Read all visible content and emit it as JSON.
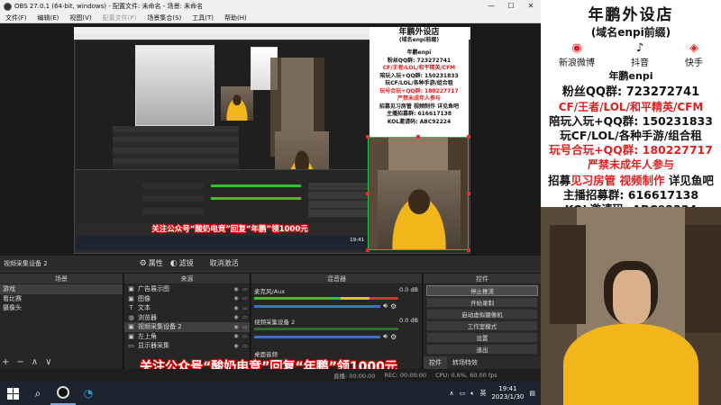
{
  "window": {
    "title": "OBS 27.0.1 (64-bit, windows) - 配置文件: 未命名 - 场景: 未命名",
    "controls": [
      "—",
      "☐",
      "✕"
    ]
  },
  "menu": [
    "文件(F)",
    "编辑(E)",
    "视图(V)",
    "配置文件(P)",
    "场景集合(S)",
    "工具(T)",
    "帮助(H)"
  ],
  "preview": {
    "nested_caption": "关注公众号“酸奶电竞”回复“年鹏”领1000元",
    "nested_time": "19:41"
  },
  "scene_bar": {
    "selected_source": "视频采集设备 2",
    "properties_label": "属性",
    "filters_label": "滤镜",
    "deactivate_label": "取消激活"
  },
  "docks": {
    "scenes_header": "场景",
    "sources_header": "来源",
    "mixer_header": "混音器",
    "controls_header": "控件"
  },
  "scenes": [
    "游戏",
    "看比赛",
    "摄像头"
  ],
  "sources": [
    {
      "icon": "image-icon",
      "glyph": "▣",
      "label": "广告展示图"
    },
    {
      "icon": "image-icon",
      "glyph": "▣",
      "label": "图像"
    },
    {
      "icon": "text-icon",
      "glyph": "T",
      "label": "文本"
    },
    {
      "icon": "globe-icon",
      "glyph": "◍",
      "label": "浏览器"
    },
    {
      "icon": "camera-icon",
      "glyph": "▣",
      "label": "视频采集设备 2"
    },
    {
      "icon": "image-icon",
      "glyph": "▣",
      "label": "左上角"
    },
    {
      "icon": "monitor-icon",
      "glyph": "▭",
      "label": "显示器采集"
    }
  ],
  "mixer": [
    {
      "name": "麦克风/Aux",
      "db": "0.0 dB"
    },
    {
      "name": "视频采集设备 2",
      "db": "0.0 dB"
    },
    {
      "name": "桌面音频",
      "db": ""
    }
  ],
  "controls": [
    "停止推流",
    "开始录制",
    "启动虚拟摄像机",
    "工作室模式",
    "设置",
    "退出"
  ],
  "controls_tabs": [
    "控件",
    "转场特效"
  ],
  "dock_toolbar": [
    "+",
    "−",
    "∧",
    "∨"
  ],
  "caption": "关注公众号“酸奶电竞”回复“年鹏”领1000元",
  "status": {
    "live": "直播: 00:00:00",
    "rec": "REC: 00:00:00",
    "cpu": "CPU: 0.6%, 60.00 fps"
  },
  "taskbar": {
    "lang": "英",
    "time": "19:41",
    "date": "2023/1/30"
  },
  "sidebar": {
    "title": "年鹏外设店",
    "subtitle": "(域名enpi前缀)",
    "social": [
      {
        "icon": "weibo-icon",
        "glyph": "◉",
        "label": "新浪微博"
      },
      {
        "icon": "douyin-icon",
        "glyph": "♪",
        "label": "抖音"
      },
      {
        "icon": "kuaishou-icon",
        "glyph": "◈",
        "label": "快手"
      }
    ],
    "handle": "年鹏enpi",
    "lines": [
      {
        "text": "粉丝QQ群: 723272741",
        "color": "blk"
      },
      {
        "text": "CF/王者/LOL/和平精英/CFM",
        "color": "red"
      },
      {
        "text": "陪玩入玩+QQ群: 150231833",
        "color": "blk"
      },
      {
        "text": "玩CF/LOL/各种手游/组合租",
        "color": "blk"
      },
      {
        "text": "玩号合玩+QQ群: 180227717",
        "color": "red"
      },
      {
        "text": "严禁未成年人参与",
        "color": "red"
      },
      {
        "text": "招募见习房管 视频制作 详见鱼吧",
        "color": "mixed"
      },
      {
        "text": "主播招募群: 616617138",
        "color": "blk"
      },
      {
        "text": "KOL邀请码: ABC92224",
        "color": "blk"
      }
    ],
    "recruit_parts": [
      "招募",
      "见习房管",
      "视频制作",
      "详见鱼吧"
    ]
  },
  "colors": {
    "accent_red": "#e02020",
    "live_green": "#32c040",
    "hoodie_yellow": "#f2b51a"
  }
}
